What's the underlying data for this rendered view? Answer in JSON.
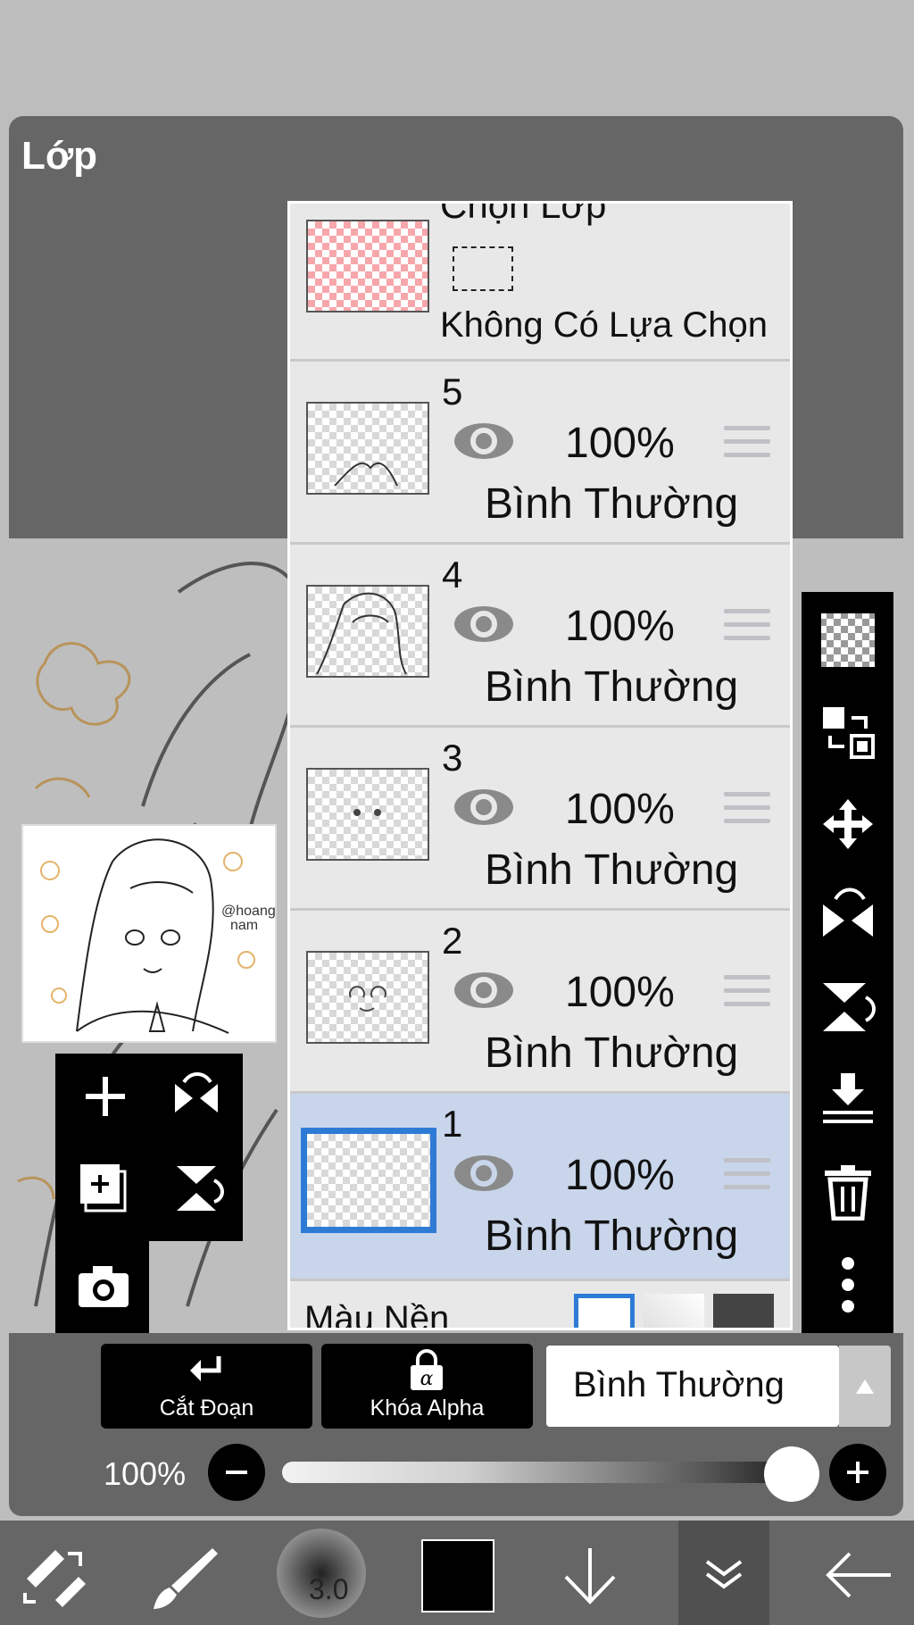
{
  "panel": {
    "title": "Lớp"
  },
  "selection_row": {
    "title": "Chọn Lớp",
    "status": "Không Có Lựa Chọn"
  },
  "layers": [
    {
      "number": "5",
      "opacity": "100%",
      "blend": "Bình Thường",
      "selected": false
    },
    {
      "number": "4",
      "opacity": "100%",
      "blend": "Bình Thường",
      "selected": false
    },
    {
      "number": "3",
      "opacity": "100%",
      "blend": "Bình Thường",
      "selected": false
    },
    {
      "number": "2",
      "opacity": "100%",
      "blend": "Bình Thường",
      "selected": false
    },
    {
      "number": "1",
      "opacity": "100%",
      "blend": "Bình Thường",
      "selected": true
    }
  ],
  "background_row": {
    "label": "Màu Nền"
  },
  "right_tools": [
    "checkerboard-icon",
    "swap-layer-icon",
    "move-icon",
    "flip-horizontal-icon",
    "flip-vertical-icon",
    "merge-down-icon",
    "trash-icon",
    "more-icon"
  ],
  "left_tools": [
    "add-layer-icon",
    "flip-h-icon",
    "duplicate-layer-icon",
    "flip-v-icon",
    "camera-icon"
  ],
  "bottom": {
    "clip_label": "Cắt Đoạn",
    "alpha_label": "Khóa Alpha",
    "blend_mode": "Bình Thường",
    "opacity_value": "100%",
    "opacity_fraction": 1.0
  },
  "toolbar": {
    "brush_size": "3.0",
    "color": "#000000",
    "icons": [
      "transform-icon",
      "brush-icon",
      "brush-size-icon",
      "color-icon",
      "down-arrow-icon",
      "layers-menu-icon",
      "back-arrow-icon"
    ]
  },
  "colors": {
    "accent": "#2e7bd6",
    "selected_row": "#c8d5ea",
    "panel": "#666666"
  }
}
